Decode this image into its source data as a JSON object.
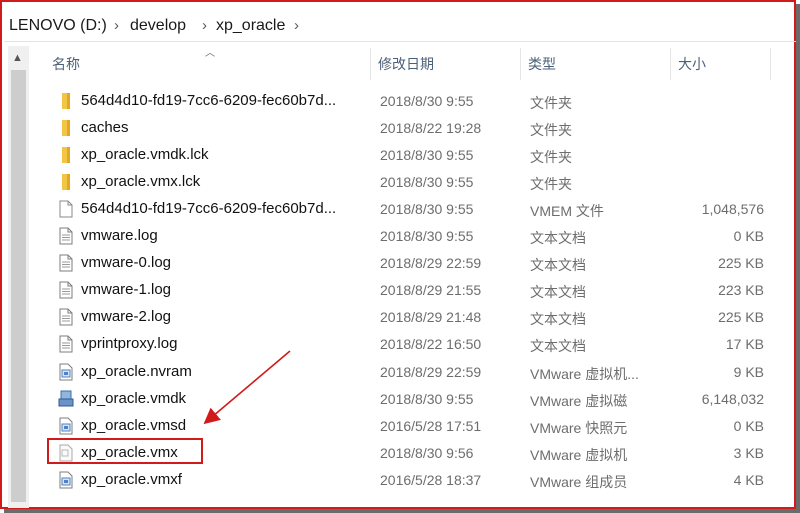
{
  "breadcrumb": [
    "LENOVO (D:)",
    "develop",
    "xp_oracle"
  ],
  "columns": {
    "name": "名称",
    "date": "修改日期",
    "type": "类型",
    "size": "大小"
  },
  "files": [
    {
      "name": "564d4d10-fd19-7cc6-6209-fec60b7d...",
      "date": "2018/8/30 9:55",
      "type": "文件夹",
      "size": "",
      "icon": "folder-icon"
    },
    {
      "name": "caches",
      "date": "2018/8/22 19:28",
      "type": "文件夹",
      "size": "",
      "icon": "folder-icon"
    },
    {
      "name": "xp_oracle.vmdk.lck",
      "date": "2018/8/30 9:55",
      "type": "文件夹",
      "size": "",
      "icon": "folder-icon"
    },
    {
      "name": "xp_oracle.vmx.lck",
      "date": "2018/8/30 9:55",
      "type": "文件夹",
      "size": "",
      "icon": "folder-icon"
    },
    {
      "name": "564d4d10-fd19-7cc6-6209-fec60b7d...",
      "date": "2018/8/30 9:55",
      "type": "VMEM 文件",
      "size": "1,048,576",
      "icon": "blank-file-icon"
    },
    {
      "name": "vmware.log",
      "date": "2018/8/30 9:55",
      "type": "文本文档",
      "size": "0 KB",
      "icon": "text-file-icon"
    },
    {
      "name": "vmware-0.log",
      "date": "2018/8/29 22:59",
      "type": "文本文档",
      "size": "225 KB",
      "icon": "text-file-icon"
    },
    {
      "name": "vmware-1.log",
      "date": "2018/8/29 21:55",
      "type": "文本文档",
      "size": "223 KB",
      "icon": "text-file-icon"
    },
    {
      "name": "vmware-2.log",
      "date": "2018/8/29 21:48",
      "type": "文本文档",
      "size": "225 KB",
      "icon": "text-file-icon"
    },
    {
      "name": "vprintproxy.log",
      "date": "2018/8/22 16:50",
      "type": "文本文档",
      "size": "17 KB",
      "icon": "text-file-icon"
    },
    {
      "name": "xp_oracle.nvram",
      "date": "2018/8/29 22:59",
      "type": "VMware 虚拟机...",
      "size": "9 KB",
      "icon": "vmware-file-icon"
    },
    {
      "name": "xp_oracle.vmdk",
      "date": "2018/8/30 9:55",
      "type": "VMware 虚拟磁",
      "size": "6,148,032",
      "icon": "vmware-disk-icon"
    },
    {
      "name": "xp_oracle.vmsd",
      "date": "2016/5/28 17:51",
      "type": "VMware 快照元",
      "size": "0 KB",
      "icon": "vmware-file-icon"
    },
    {
      "name": "xp_oracle.vmx",
      "date": "2018/8/30 9:56",
      "type": "VMware 虚拟机",
      "size": "3 KB",
      "icon": "vmx-file-icon"
    },
    {
      "name": "xp_oracle.vmxf",
      "date": "2016/5/28 18:37",
      "type": "VMware 组成员",
      "size": "4 KB",
      "icon": "vmware-file-icon"
    }
  ],
  "annotation": {
    "highlighted_file": "xp_oracle.vmx",
    "color": "#d11a1a"
  }
}
